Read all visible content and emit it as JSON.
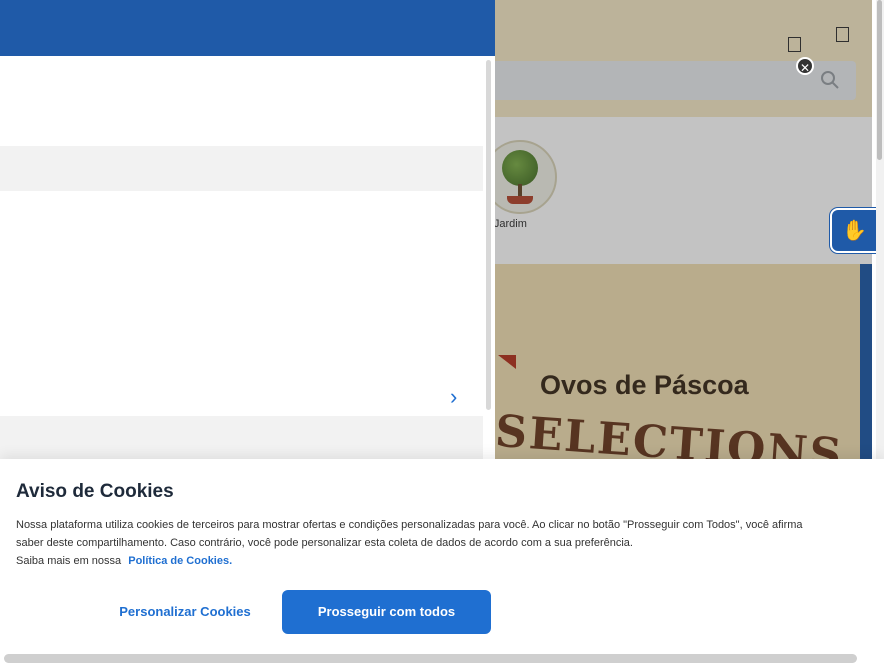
{
  "background": {
    "category_label": "sa e Jardim",
    "banner_title": "Ovos de Páscoa",
    "banner_subtitle": "SELECTIONS"
  },
  "icons": {
    "search": "search-icon",
    "close": "close-icon",
    "accessibility": "sign-language-icon",
    "chevron": "chevron-right-icon"
  },
  "colors": {
    "brand_blue": "#1f5aa8",
    "link_blue": "#1f6fd1",
    "header_bg": "#f5e9c6"
  },
  "cookie": {
    "title": "Aviso de Cookies",
    "body": "Nossa plataforma utiliza cookies de terceiros para mostrar ofertas e condições personalizadas para você. Ao clicar no botão \"Prosseguir com Todos\", você afirma saber deste compartilhamento. Caso contrário, você pode personalizar esta coleta de dados de acordo com a sua preferência.",
    "more_prefix": "Saiba mais em nossa",
    "policy_link": "Política de Cookies.",
    "personalize_label": "Personalizar Cookies",
    "accept_label": "Prosseguir com todos"
  }
}
